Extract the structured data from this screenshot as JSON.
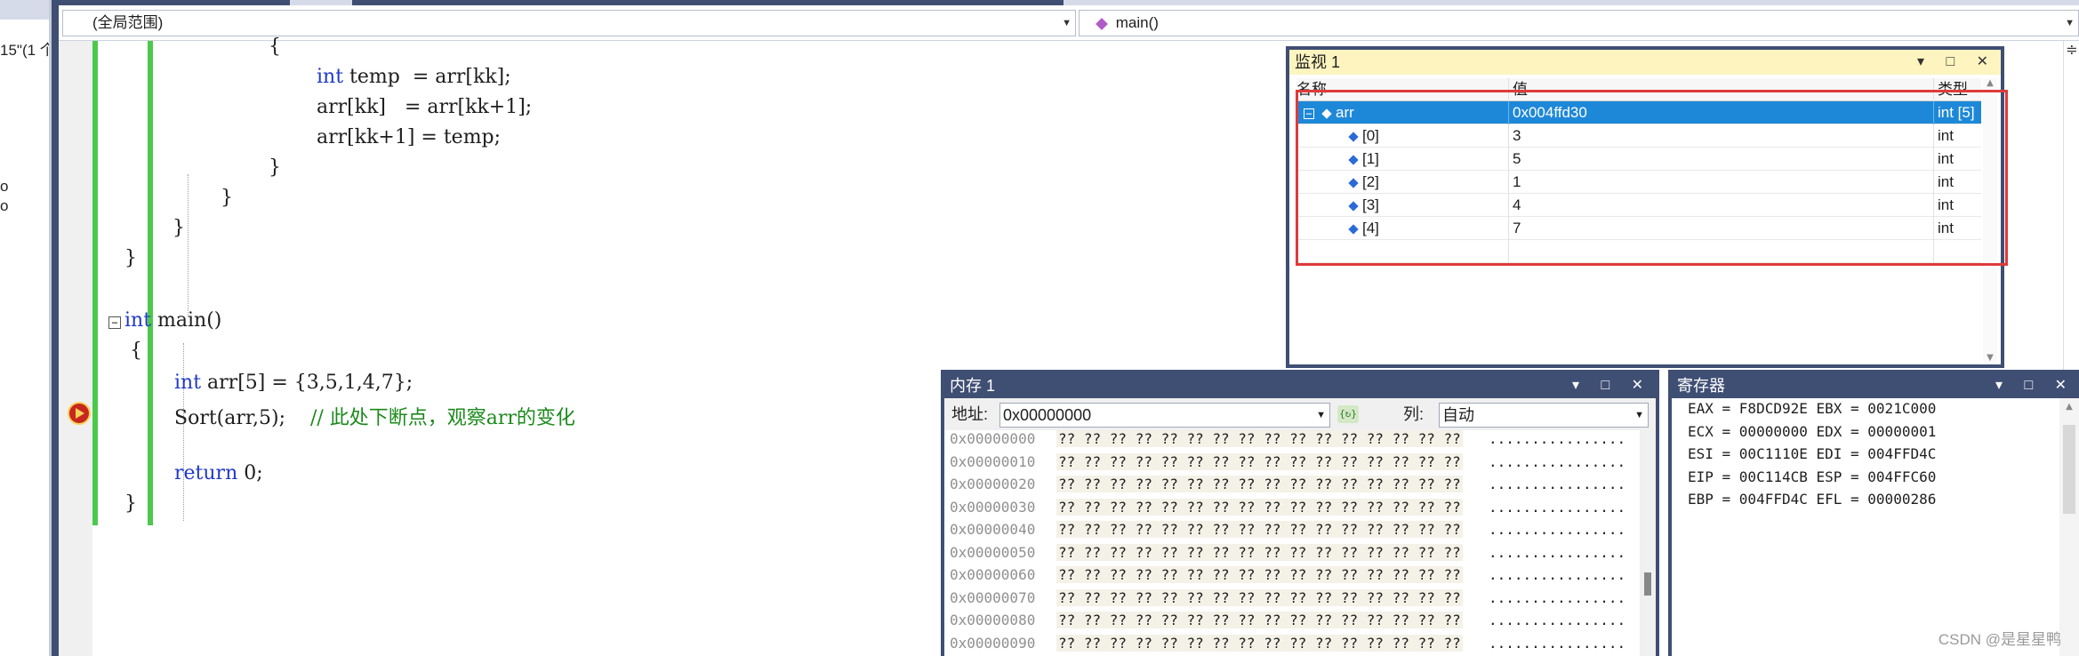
{
  "left_fragments": [
    "15\"(1 个",
    "o",
    "o"
  ],
  "navbar": {
    "scope": "(全局范围)",
    "function": "main()"
  },
  "code": {
    "l_brace1": "{",
    "l_temp_kw": "int",
    "l_temp_rest": " temp  = arr[kk];",
    "l_assign1": "arr[kk]   = arr[kk+1];",
    "l_assign2": "arr[kk+1] = temp;",
    "l_close1": "}",
    "l_close2": "}",
    "l_close3": "}",
    "l_close4": "}",
    "l_main_kw": "int",
    "l_main_rest": " main()",
    "l_main_open": "{",
    "l_arr_kw": "int",
    "l_arr_rest": " arr[5] = {3,5,1,4,7};",
    "l_sort": "Sort(arr,5);    ",
    "l_sort_comment": "// 此处下断点，观察arr的变化",
    "l_return_kw": "return",
    "l_return_rest": " 0;",
    "l_main_close": "}",
    "fold_minus": "−"
  },
  "watch": {
    "title": "监视 1",
    "columns": {
      "name": "名称",
      "value": "值",
      "type": "类型"
    },
    "root": {
      "name": "arr",
      "value": "0x004ffd30",
      "type": "int [5]",
      "expander": "−"
    },
    "items": [
      {
        "name": "[0]",
        "value": "3",
        "type": "int"
      },
      {
        "name": "[1]",
        "value": "5",
        "type": "int"
      },
      {
        "name": "[2]",
        "value": "1",
        "type": "int"
      },
      {
        "name": "[3]",
        "value": "4",
        "type": "int"
      },
      {
        "name": "[4]",
        "value": "7",
        "type": "int"
      }
    ]
  },
  "memory": {
    "title": "内存 1",
    "address_label": "地址:",
    "address_value": "0x00000000",
    "columns_label": "列:",
    "columns_value": "自动",
    "rows": [
      {
        "addr": "0x00000000",
        "bytes": "?? ?? ?? ?? ?? ?? ?? ?? ?? ?? ?? ?? ?? ?? ?? ??",
        "ascii": "................"
      },
      {
        "addr": "0x00000010",
        "bytes": "?? ?? ?? ?? ?? ?? ?? ?? ?? ?? ?? ?? ?? ?? ?? ??",
        "ascii": "................"
      },
      {
        "addr": "0x00000020",
        "bytes": "?? ?? ?? ?? ?? ?? ?? ?? ?? ?? ?? ?? ?? ?? ?? ??",
        "ascii": "................"
      },
      {
        "addr": "0x00000030",
        "bytes": "?? ?? ?? ?? ?? ?? ?? ?? ?? ?? ?? ?? ?? ?? ?? ??",
        "ascii": "................"
      },
      {
        "addr": "0x00000040",
        "bytes": "?? ?? ?? ?? ?? ?? ?? ?? ?? ?? ?? ?? ?? ?? ?? ??",
        "ascii": "................"
      },
      {
        "addr": "0x00000050",
        "bytes": "?? ?? ?? ?? ?? ?? ?? ?? ?? ?? ?? ?? ?? ?? ?? ??",
        "ascii": "................"
      },
      {
        "addr": "0x00000060",
        "bytes": "?? ?? ?? ?? ?? ?? ?? ?? ?? ?? ?? ?? ?? ?? ?? ??",
        "ascii": "................"
      },
      {
        "addr": "0x00000070",
        "bytes": "?? ?? ?? ?? ?? ?? ?? ?? ?? ?? ?? ?? ?? ?? ?? ??",
        "ascii": "................"
      },
      {
        "addr": "0x00000080",
        "bytes": "?? ?? ?? ?? ?? ?? ?? ?? ?? ?? ?? ?? ?? ?? ?? ??",
        "ascii": "................"
      },
      {
        "addr": "0x00000090",
        "bytes": "?? ?? ?? ?? ?? ?? ?? ?? ?? ?? ?? ?? ?? ?? ?? ??",
        "ascii": "................"
      }
    ]
  },
  "registers": {
    "title": "寄存器",
    "lines": [
      "EAX = F8DCD92E EBX = 0021C000",
      "ECX = 00000000 EDX = 00000001",
      "ESI = 00C1110E EDI = 004FFD4C",
      "EIP = 00C114CB ESP = 004FFC60",
      "EBP = 004FFD4C EFL = 00000286"
    ]
  },
  "window_buttons": "▾ □ ✕",
  "watermark": "CSDN @是星星鸭",
  "colors": {
    "keyword": "#1f38c9",
    "comment": "#1b8a1b",
    "selection": "#1e88d8",
    "highlight_box": "#e03a3a",
    "frame": "#3f4e73",
    "watch_title_bg": "#fdf4bf"
  }
}
